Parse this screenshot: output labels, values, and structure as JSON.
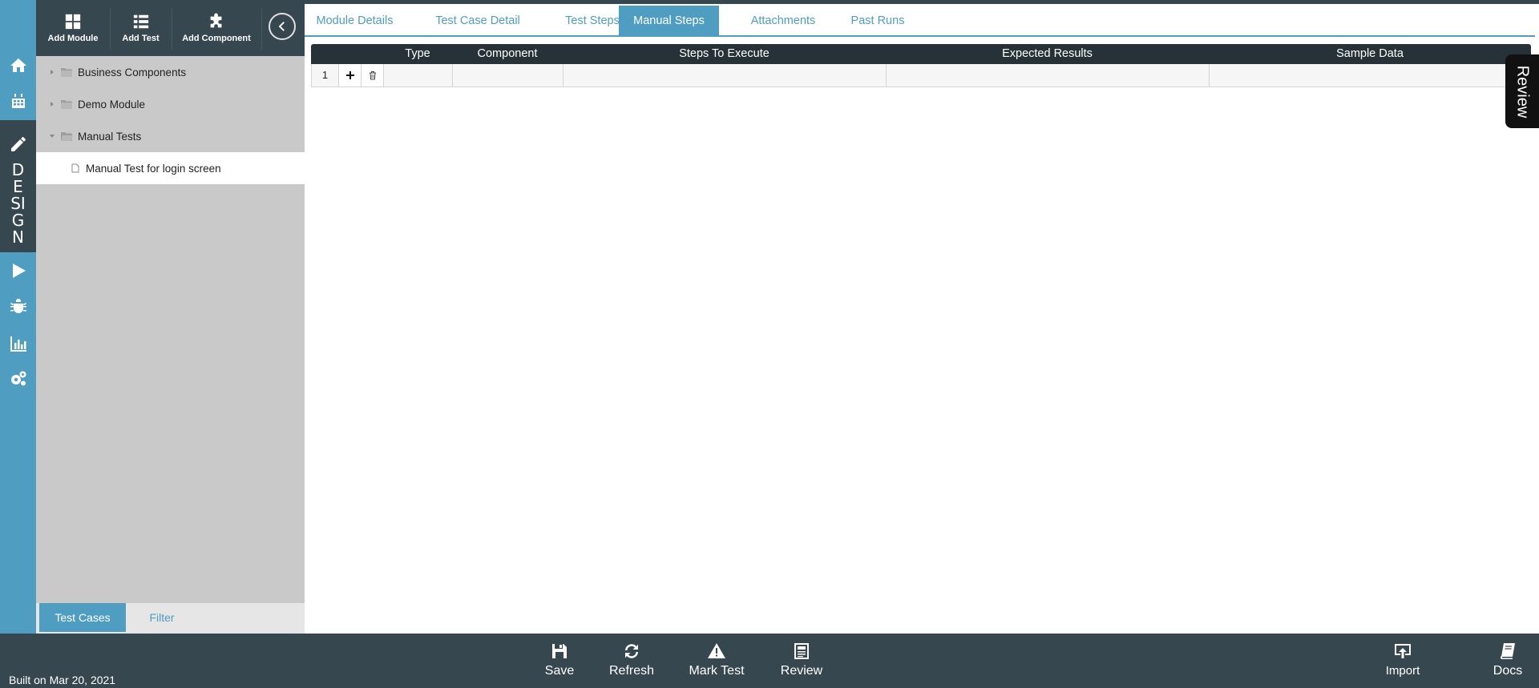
{
  "sidebar": {
    "design_letters": [
      "D",
      "E",
      "SI",
      "G",
      "N"
    ]
  },
  "toolbar": {
    "add_module": "Add Module",
    "add_test": "Add Test",
    "add_component": "Add Component"
  },
  "tree": {
    "nodes": [
      {
        "label": "Business Components"
      },
      {
        "label": "Demo Module"
      },
      {
        "label": "Manual Tests"
      }
    ],
    "selected_child": "Manual Test for login screen"
  },
  "tree_tabs": {
    "test_cases": "Test Cases",
    "filter": "Filter"
  },
  "tabs": [
    {
      "label": "Module Details"
    },
    {
      "label": "Test Case Detail"
    },
    {
      "label": "Test Steps"
    },
    {
      "label": "Manual Steps",
      "active": true
    },
    {
      "label": "Attachments"
    },
    {
      "label": "Past Runs"
    }
  ],
  "grid": {
    "columns": [
      "Type",
      "Component",
      "Steps To Execute",
      "Expected Results",
      "Sample Data"
    ],
    "rows": [
      {
        "number": "1",
        "type": "",
        "component": "",
        "steps": "",
        "expected": "",
        "sample": ""
      }
    ]
  },
  "review_tab": "Review",
  "footer": {
    "built_on": "Built on Mar 20, 2021",
    "save": "Save",
    "refresh": "Refresh",
    "mark_test": "Mark Test",
    "review": "Review",
    "import": "Import",
    "docs": "Docs"
  },
  "colors": {
    "accent": "#4f9dc0",
    "dark": "#37474f",
    "grid_header": "#263238",
    "tree_bg": "#c9c9c9"
  }
}
